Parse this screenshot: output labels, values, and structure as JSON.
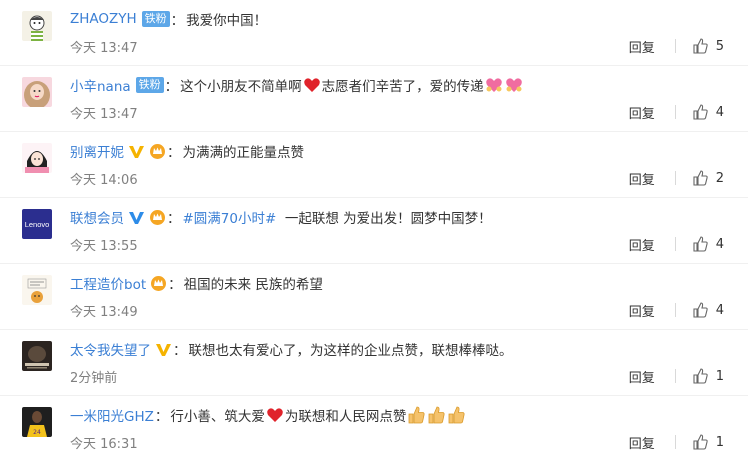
{
  "reply_label": "回复",
  "colors": {
    "link_blue": "#3b7fd4",
    "fan_tag": "#5da7e8",
    "time_gray": "#808080",
    "verified_gold": "#f5b300"
  },
  "comments": [
    {
      "user": "ZHAOZYH",
      "tag": "铁粉",
      "parts": [
        {
          "t": "我爱你中国！"
        }
      ],
      "time": "今天 13:47",
      "likes": "5",
      "avatar": "avatar-cartoon-person"
    },
    {
      "user": "小辛nana",
      "tag": "铁粉",
      "parts": [
        {
          "t": "这个小朋友不简单啊"
        },
        {
          "emo": "heart"
        },
        {
          "t": "志愿者们辛苦了，爱的传递"
        },
        {
          "emo": "pink-heart-hands"
        },
        {
          "emo": "pink-heart-hands"
        }
      ],
      "time": "今天 13:47",
      "likes": "4",
      "avatar": "avatar-girl-pink"
    },
    {
      "user": "别离开妮",
      "badge": "v",
      "parts": [
        {
          "t": "为满满的正能量点赞"
        }
      ],
      "time": "今天 14:06",
      "likes": "2",
      "avatar": "avatar-cartoon-girl"
    },
    {
      "user": "联想会员",
      "badge": "v-blue",
      "parts": [
        {
          "h": "#圆满70小时#"
        },
        {
          "t": "  一起联想 为爱出发！圆梦中国梦！"
        }
      ],
      "time": "今天 13:55",
      "likes": "4",
      "avatar": "avatar-lenovo",
      "avatar_text": "Lenovo"
    },
    {
      "user": "工程造价bot",
      "badge": "",
      "parts": [
        {
          "t": "祖国的未来 民族的希望"
        }
      ],
      "time": "今天 13:49",
      "likes": "4",
      "avatar": "avatar-bot"
    },
    {
      "user": "太令我失望了",
      "badge": "v",
      "parts": [
        {
          "t": "联想也太有爱心了，为这样的企业点赞，联想棒棒哒。"
        }
      ],
      "time": "2分钟前",
      "likes": "1",
      "avatar": "avatar-dark-poster"
    },
    {
      "user": "一米阳光GHZ",
      "parts": [
        {
          "t": "行小善、筑大爱"
        },
        {
          "emo": "heart"
        },
        {
          "t": "为联想和人民网点赞"
        },
        {
          "emo": "thumbs-up"
        },
        {
          "emo": "thumbs-up"
        },
        {
          "emo": "thumbs-up"
        }
      ],
      "time": "今天 16:31",
      "likes": "1",
      "avatar": "avatar-basketball"
    }
  ]
}
